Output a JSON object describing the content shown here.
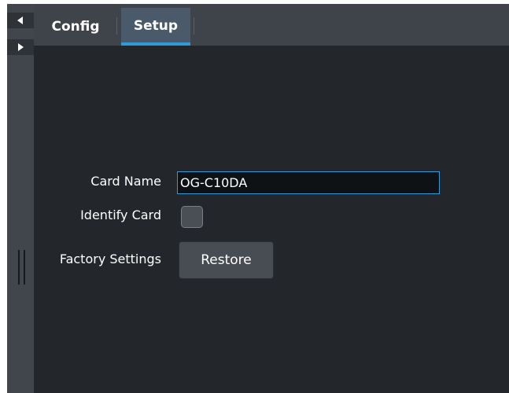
{
  "tabs": {
    "config_label": "Config",
    "setup_label": "Setup",
    "active": "Setup"
  },
  "form": {
    "card_name_label": "Card Name",
    "card_name_value": "OG-C10DA",
    "identify_card_label": "Identify Card",
    "identify_card_checked": false,
    "factory_settings_label": "Factory Settings",
    "restore_label": "Restore"
  },
  "colors": {
    "background": "#23272b",
    "tab_bar": "#3f444a",
    "active_tab": "#4a5a6b",
    "accent": "#2f9bd6",
    "button": "#484d54"
  },
  "icons": {
    "nav_left": "triangle-left-icon",
    "nav_right": "triangle-right-icon"
  }
}
